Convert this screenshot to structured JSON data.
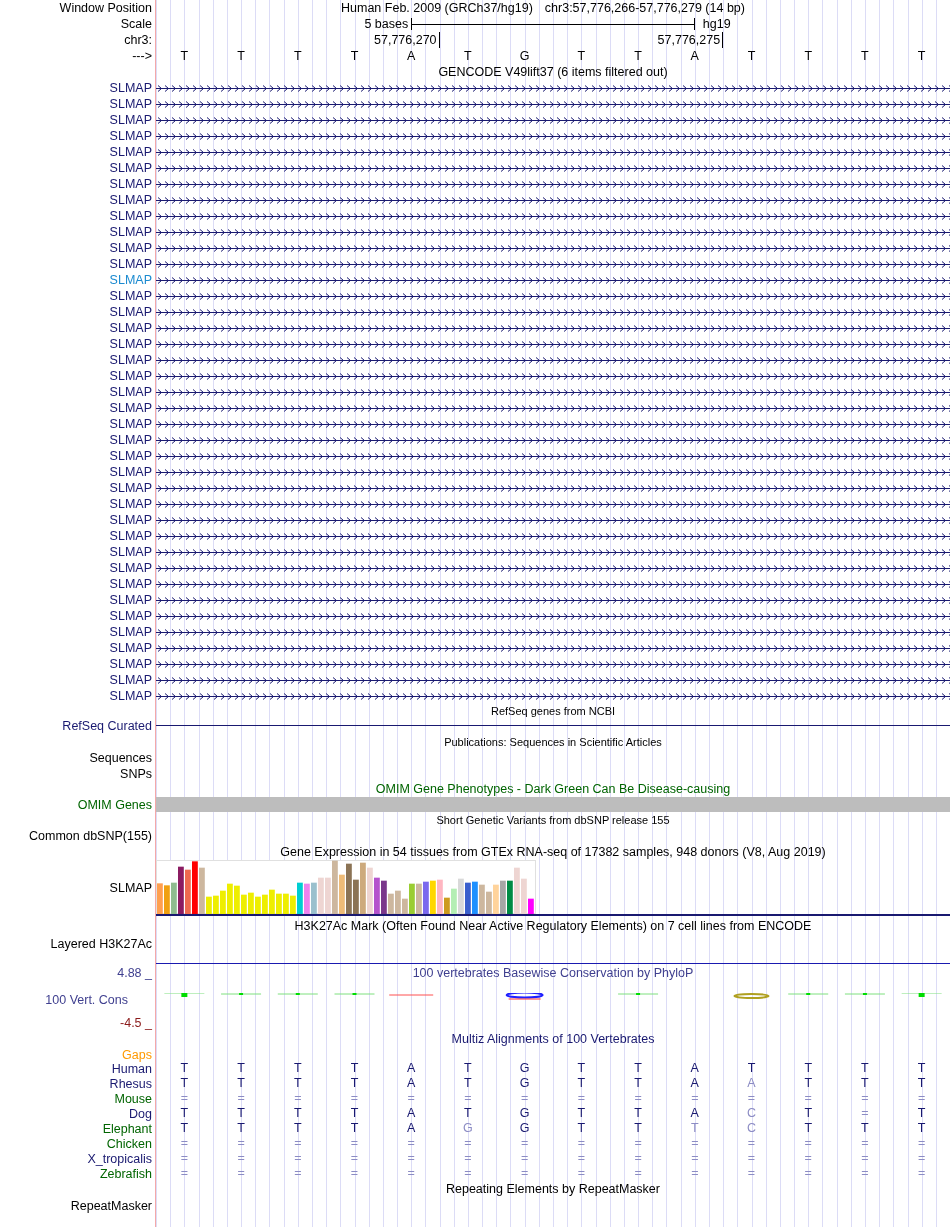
{
  "position_row": {
    "label": "Window Position",
    "assembly": "Human Feb. 2009 (GRCh37/hg19)",
    "range": "chr3:57,776,266-57,776,279 (14 bp)"
  },
  "scale_row": {
    "label": "Scale",
    "span": "5 bases",
    "assembly": "hg19"
  },
  "coord_row": {
    "label": "chr3:",
    "ticks": [
      "57,776,270",
      "57,776,275"
    ]
  },
  "strand_row": {
    "label": "--->",
    "bases": [
      "T",
      "T",
      "T",
      "T",
      "A",
      "T",
      "G",
      "T",
      "T",
      "A",
      "T",
      "T",
      "T",
      "T"
    ]
  },
  "gencode": {
    "title": "GENCODE V49lift37 (6 items filtered out)",
    "items": [
      {
        "label": "SLMAP",
        "highlighted": false
      },
      {
        "label": "SLMAP",
        "highlighted": false
      },
      {
        "label": "SLMAP",
        "highlighted": false
      },
      {
        "label": "SLMAP",
        "highlighted": false
      },
      {
        "label": "SLMAP",
        "highlighted": false
      },
      {
        "label": "SLMAP",
        "highlighted": false
      },
      {
        "label": "SLMAP",
        "highlighted": false
      },
      {
        "label": "SLMAP",
        "highlighted": false
      },
      {
        "label": "SLMAP",
        "highlighted": false
      },
      {
        "label": "SLMAP",
        "highlighted": false
      },
      {
        "label": "SLMAP",
        "highlighted": false
      },
      {
        "label": "SLMAP",
        "highlighted": false
      },
      {
        "label": "SLMAP",
        "highlighted": true
      },
      {
        "label": "SLMAP",
        "highlighted": false
      },
      {
        "label": "SLMAP",
        "highlighted": false
      },
      {
        "label": "SLMAP",
        "highlighted": false
      },
      {
        "label": "SLMAP",
        "highlighted": false
      },
      {
        "label": "SLMAP",
        "highlighted": false
      },
      {
        "label": "SLMAP",
        "highlighted": false
      },
      {
        "label": "SLMAP",
        "highlighted": false
      },
      {
        "label": "SLMAP",
        "highlighted": false
      },
      {
        "label": "SLMAP",
        "highlighted": false
      },
      {
        "label": "SLMAP",
        "highlighted": false
      },
      {
        "label": "SLMAP",
        "highlighted": false
      },
      {
        "label": "SLMAP",
        "highlighted": false
      },
      {
        "label": "SLMAP",
        "highlighted": false
      },
      {
        "label": "SLMAP",
        "highlighted": false
      },
      {
        "label": "SLMAP",
        "highlighted": false
      },
      {
        "label": "SLMAP",
        "highlighted": false
      },
      {
        "label": "SLMAP",
        "highlighted": false
      },
      {
        "label": "SLMAP",
        "highlighted": false
      },
      {
        "label": "SLMAP",
        "highlighted": false
      },
      {
        "label": "SLMAP",
        "highlighted": false
      },
      {
        "label": "SLMAP",
        "highlighted": false
      },
      {
        "label": "SLMAP",
        "highlighted": false
      },
      {
        "label": "SLMAP",
        "highlighted": false
      },
      {
        "label": "SLMAP",
        "highlighted": false
      },
      {
        "label": "SLMAP",
        "highlighted": false
      },
      {
        "label": "SLMAP",
        "highlighted": false
      }
    ]
  },
  "refseq": {
    "title": "RefSeq genes from NCBI",
    "label": "RefSeq Curated"
  },
  "publications": {
    "title": "Publications: Sequences in Scientific Articles",
    "labels": [
      "Sequences",
      "SNPs"
    ]
  },
  "omim": {
    "title": "OMIM Gene Phenotypes - Dark Green Can Be Disease-causing",
    "label": "OMIM Genes"
  },
  "dbsnp": {
    "title": "Short Genetic Variants from dbSNP release 155",
    "label": "Common dbSNP(155)"
  },
  "gtex": {
    "title": "Gene Expression in 54 tissues from GTEx RNA-seq of 17382 samples, 948 donors (V8, Aug 2019)",
    "label": "SLMAP"
  },
  "h3k27ac": {
    "title": "H3K27Ac Mark (Often Found Near Active Regulatory Elements) on 7 cell lines from ENCODE",
    "label": "Layered H3K27Ac"
  },
  "phylop": {
    "title": "100 vertebrates Basewise Conservation by PhyloP",
    "label": "100 Vert. Cons",
    "max": "4.88 _",
    "min": "-4.5 _"
  },
  "multiz": {
    "title": "Multiz Alignments of 100 Vertebrates",
    "gaps_label": "Gaps",
    "species": [
      {
        "name": "Human",
        "color": "#191970",
        "bases": [
          {
            "text": "T",
            "faded": false
          },
          {
            "text": "T",
            "faded": false
          },
          {
            "text": "T",
            "faded": false
          },
          {
            "text": "T",
            "faded": false
          },
          {
            "text": "A",
            "faded": false
          },
          {
            "text": "T",
            "faded": false
          },
          {
            "text": "G",
            "faded": false
          },
          {
            "text": "T",
            "faded": false
          },
          {
            "text": "T",
            "faded": false
          },
          {
            "text": "A",
            "faded": false
          },
          {
            "text": "T",
            "faded": false
          },
          {
            "text": "T",
            "faded": false
          },
          {
            "text": "T",
            "faded": false
          },
          {
            "text": "T",
            "faded": false
          }
        ]
      },
      {
        "name": "Rhesus",
        "color": "#191970",
        "bases": [
          {
            "text": "T",
            "faded": false
          },
          {
            "text": "T",
            "faded": false
          },
          {
            "text": "T",
            "faded": false
          },
          {
            "text": "T",
            "faded": false
          },
          {
            "text": "A",
            "faded": false
          },
          {
            "text": "T",
            "faded": false
          },
          {
            "text": "G",
            "faded": false
          },
          {
            "text": "T",
            "faded": false
          },
          {
            "text": "T",
            "faded": false
          },
          {
            "text": "A",
            "faded": false
          },
          {
            "text": "A",
            "faded": true
          },
          {
            "text": "T",
            "faded": false
          },
          {
            "text": "T",
            "faded": false
          },
          {
            "text": "T",
            "faded": false
          }
        ]
      },
      {
        "name": "Mouse",
        "color": "#006400",
        "bases": [
          {
            "text": "=",
            "faded": true
          },
          {
            "text": "=",
            "faded": true
          },
          {
            "text": "=",
            "faded": true
          },
          {
            "text": "=",
            "faded": true
          },
          {
            "text": "=",
            "faded": true
          },
          {
            "text": "=",
            "faded": true
          },
          {
            "text": "=",
            "faded": true
          },
          {
            "text": "=",
            "faded": true
          },
          {
            "text": "=",
            "faded": true
          },
          {
            "text": "=",
            "faded": true
          },
          {
            "text": "=",
            "faded": true
          },
          {
            "text": "=",
            "faded": true
          },
          {
            "text": "=",
            "faded": true
          },
          {
            "text": "=",
            "faded": true
          }
        ]
      },
      {
        "name": "Dog",
        "color": "#191970",
        "bases": [
          {
            "text": "T",
            "faded": false
          },
          {
            "text": "T",
            "faded": false
          },
          {
            "text": "T",
            "faded": false
          },
          {
            "text": "T",
            "faded": false
          },
          {
            "text": "A",
            "faded": false
          },
          {
            "text": "T",
            "faded": false
          },
          {
            "text": "G",
            "faded": false
          },
          {
            "text": "T",
            "faded": false
          },
          {
            "text": "T",
            "faded": false
          },
          {
            "text": "A",
            "faded": false
          },
          {
            "text": "C",
            "faded": true
          },
          {
            "text": "T",
            "faded": false
          },
          {
            "text": "=",
            "faded": true
          },
          {
            "text": "T",
            "faded": false
          }
        ]
      },
      {
        "name": "Elephant",
        "color": "#006400",
        "bases": [
          {
            "text": "T",
            "faded": false
          },
          {
            "text": "T",
            "faded": false
          },
          {
            "text": "T",
            "faded": false
          },
          {
            "text": "T",
            "faded": false
          },
          {
            "text": "A",
            "faded": false
          },
          {
            "text": "G",
            "faded": true
          },
          {
            "text": "G",
            "faded": false
          },
          {
            "text": "T",
            "faded": false
          },
          {
            "text": "T",
            "faded": false
          },
          {
            "text": "T",
            "faded": true
          },
          {
            "text": "C",
            "faded": true
          },
          {
            "text": "T",
            "faded": false
          },
          {
            "text": "T",
            "faded": false
          },
          {
            "text": "T",
            "faded": false
          }
        ]
      },
      {
        "name": "Chicken",
        "color": "#006400",
        "bases": [
          {
            "text": "=",
            "faded": true
          },
          {
            "text": "=",
            "faded": true
          },
          {
            "text": "=",
            "faded": true
          },
          {
            "text": "=",
            "faded": true
          },
          {
            "text": "=",
            "faded": true
          },
          {
            "text": "=",
            "faded": true
          },
          {
            "text": "=",
            "faded": true
          },
          {
            "text": "=",
            "faded": true
          },
          {
            "text": "=",
            "faded": true
          },
          {
            "text": "=",
            "faded": true
          },
          {
            "text": "=",
            "faded": true
          },
          {
            "text": "=",
            "faded": true
          },
          {
            "text": "=",
            "faded": true
          },
          {
            "text": "=",
            "faded": true
          }
        ]
      },
      {
        "name": "X_tropicalis",
        "color": "#191970",
        "bases": [
          {
            "text": "=",
            "faded": true
          },
          {
            "text": "=",
            "faded": true
          },
          {
            "text": "=",
            "faded": true
          },
          {
            "text": "=",
            "faded": true
          },
          {
            "text": "=",
            "faded": true
          },
          {
            "text": "=",
            "faded": true
          },
          {
            "text": "=",
            "faded": true
          },
          {
            "text": "=",
            "faded": true
          },
          {
            "text": "=",
            "faded": true
          },
          {
            "text": "=",
            "faded": true
          },
          {
            "text": "=",
            "faded": true
          },
          {
            "text": "=",
            "faded": true
          },
          {
            "text": "=",
            "faded": true
          },
          {
            "text": "=",
            "faded": true
          }
        ]
      },
      {
        "name": "Zebrafish",
        "color": "#006400",
        "bases": [
          {
            "text": "=",
            "faded": true
          },
          {
            "text": "=",
            "faded": true
          },
          {
            "text": "=",
            "faded": true
          },
          {
            "text": "=",
            "faded": true
          },
          {
            "text": "=",
            "faded": true
          },
          {
            "text": "=",
            "faded": true
          },
          {
            "text": "=",
            "faded": true
          },
          {
            "text": "=",
            "faded": true
          },
          {
            "text": "=",
            "faded": true
          },
          {
            "text": "=",
            "faded": true
          },
          {
            "text": "=",
            "faded": true
          },
          {
            "text": "=",
            "faded": true
          },
          {
            "text": "=",
            "faded": true
          },
          {
            "text": "=",
            "faded": true
          }
        ]
      }
    ]
  },
  "repeatmasker": {
    "title": "Repeating Elements by RepeatMasker",
    "label": "RepeatMasker"
  }
}
